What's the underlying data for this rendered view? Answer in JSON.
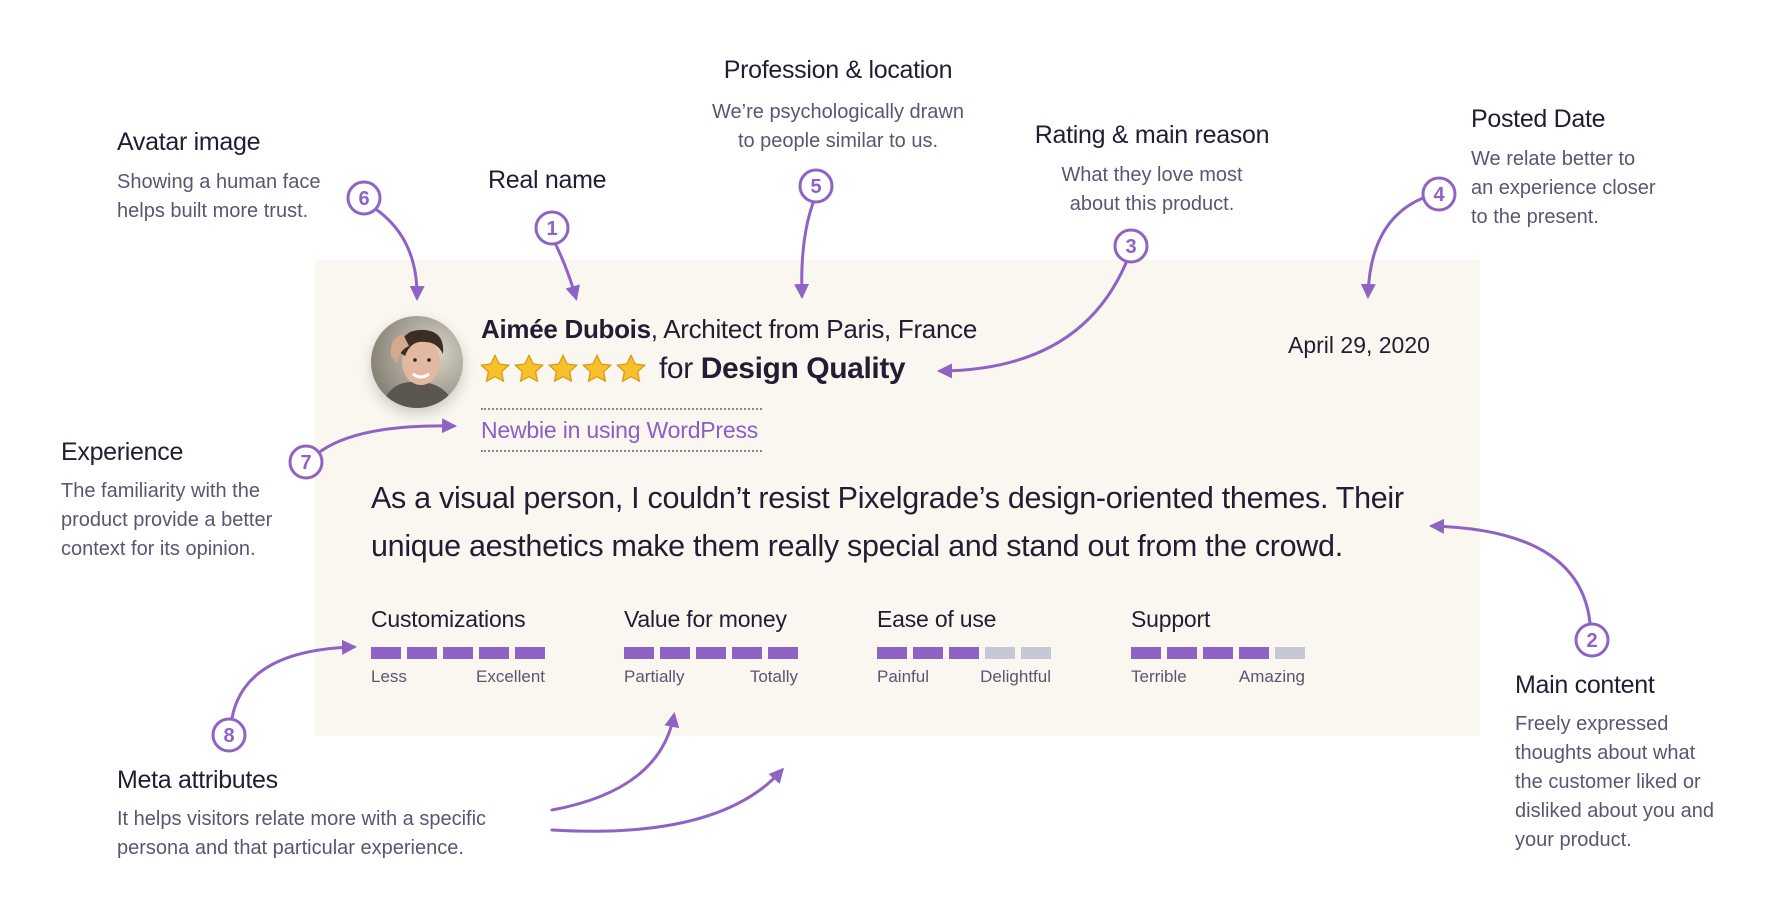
{
  "accent_color": "#8f63c4",
  "card_background": "#faf6f0",
  "review": {
    "name": "Aimée Dubois",
    "profession_location": ", Architect from Paris, France",
    "rating_stars": 5,
    "rating_max": 5,
    "rating_prefix": "for",
    "rating_reason": "Design Quality",
    "experience": "Newbie in using WordPress",
    "date": "April 29, 2020",
    "quote": "As a visual person, I couldn’t resist Pixelgrade’s design-oriented themes. Their unique aesthetics make them really special and stand out from the crowd.",
    "avatar_icon": "person-portrait-icon",
    "meta": [
      {
        "label": "Customizations",
        "value": 5,
        "max": 5,
        "low": "Less",
        "high": "Excellent"
      },
      {
        "label": "Value for money",
        "value": 5,
        "max": 5,
        "low": "Partially",
        "high": "Totally"
      },
      {
        "label": "Ease of use",
        "value": 3,
        "max": 5,
        "low": "Painful",
        "high": "Delightful"
      },
      {
        "label": "Support",
        "value": 4,
        "max": 5,
        "low": "Terrible",
        "high": "Amazing"
      }
    ]
  },
  "annotations": [
    {
      "number": "1",
      "title": "Real name",
      "lines": []
    },
    {
      "number": "2",
      "title": "Main content",
      "lines": [
        "Freely expressed",
        "thoughts about what",
        "the customer liked or",
        "disliked about you and",
        "your product."
      ]
    },
    {
      "number": "3",
      "title": "Rating & main reason",
      "lines": [
        "What they love most",
        "about this product."
      ]
    },
    {
      "number": "4",
      "title": "Posted Date",
      "lines": [
        "We relate better to",
        "an experience closer",
        "to the present."
      ]
    },
    {
      "number": "5",
      "title": "Profession & location",
      "lines": [
        "We’re psychologically drawn",
        "to people similar to us."
      ]
    },
    {
      "number": "6",
      "title": "Avatar image",
      "lines": [
        "Showing a human face",
        "helps built more trust."
      ]
    },
    {
      "number": "7",
      "title": "Experience",
      "lines": [
        "The familiarity with the",
        "product provide a better",
        "context for its opinion."
      ]
    },
    {
      "number": "8",
      "title": "Meta attributes",
      "lines": [
        "It helps visitors relate more with a specific",
        "persona and that particular experience."
      ]
    }
  ]
}
